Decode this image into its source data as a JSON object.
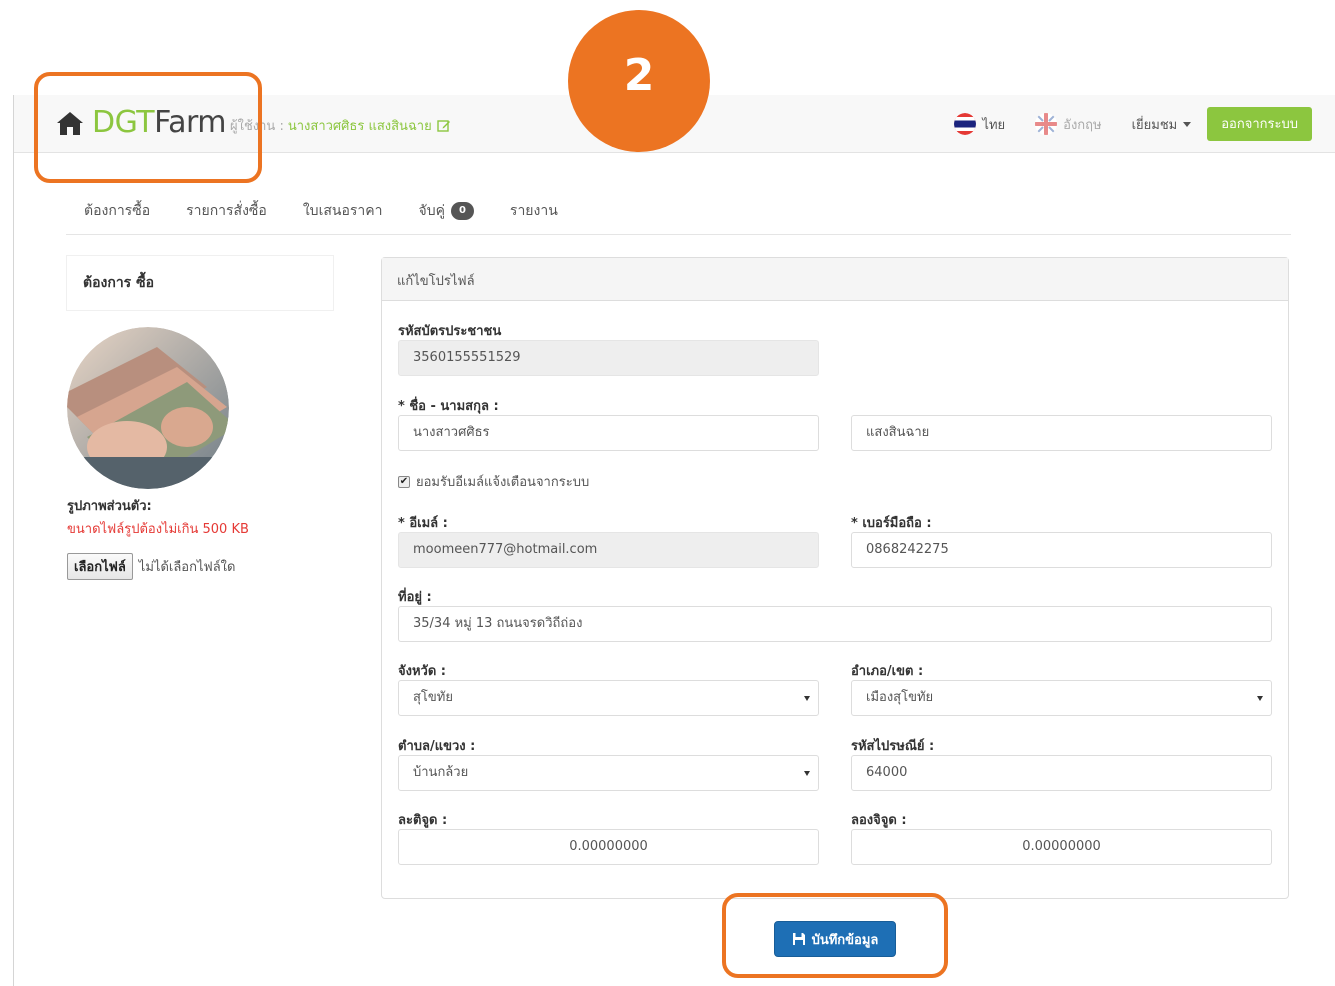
{
  "step_badge": "2",
  "brand": {
    "logo_part1": "DGT",
    "logo_part2": "Farm"
  },
  "user": {
    "label": "ผู้ใช้งาน :",
    "name": "นางสาวศศิธร แสงสินฉาย"
  },
  "nav": {
    "lang_thai": "ไทย",
    "lang_english": "อังกฤษ",
    "visit": "เยี่ยมชม",
    "logout": "ออกจากระบบ"
  },
  "tabs": [
    {
      "label": "ต้องการซื้อ"
    },
    {
      "label": "รายการสั่งซื้อ"
    },
    {
      "label": "ใบเสนอราคา"
    },
    {
      "label": "จับคู่",
      "badge": "0"
    },
    {
      "label": "รายงาน"
    }
  ],
  "sidebar": {
    "title": "ต้องการ ซื้อ",
    "photo_label": "รูปภาพส่วนตัว:",
    "photo_hint": "ขนาดไฟล์รูปต้องไม่เกิน 500 KB",
    "file_button": "เลือกไฟล์",
    "file_status": "ไม่ได้เลือกไฟล์ใด"
  },
  "form": {
    "heading": "แก้ไขโปรไฟล์",
    "id_card": {
      "label": "รหัสบัตรประชาชน",
      "value": "3560155551529"
    },
    "name": {
      "label": "* ชื่อ - นามสกุล :",
      "first": "นางสาวศศิธร",
      "last": "แสงสินฉาย"
    },
    "email_consent": {
      "label": "ยอมรับอีเมล์แจ้งเตือนจากระบบ",
      "checked": true
    },
    "email": {
      "label": "* อีเมล์ :",
      "value": "moomeen777@hotmail.com"
    },
    "mobile": {
      "label": "* เบอร์มือถือ :",
      "value": "0868242275"
    },
    "address": {
      "label": "ที่อยู่ :",
      "value": "35/34 หมู่ 13 ถนนจรดวิถีถ่อง"
    },
    "province": {
      "label": "จังหวัด :",
      "value": "สุโขทัย"
    },
    "district": {
      "label": "อำเภอ/เขต :",
      "value": "เมืองสุโขทัย"
    },
    "subdistrict": {
      "label": "ตำบล/แขวง :",
      "value": "บ้านกล้วย"
    },
    "postcode": {
      "label": "รหัสไปรษณีย์ :",
      "value": "64000"
    },
    "latitude": {
      "label": "ละติจูด :",
      "value": "0.00000000"
    },
    "longitude": {
      "label": "ลองจิจูด :",
      "value": "0.00000000"
    }
  },
  "save_button": "บันทึกข้อมูล",
  "colors": {
    "brand_green": "#8cc63f",
    "highlight_orange": "#ec7422",
    "save_blue": "#1e6fb5"
  }
}
